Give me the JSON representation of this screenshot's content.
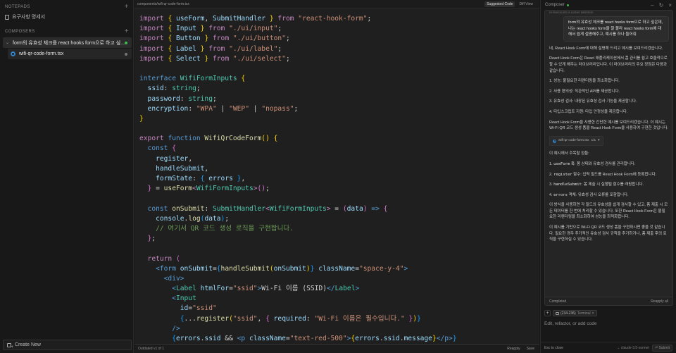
{
  "sidebar": {
    "notepads_header": "NOTEPADS",
    "notepads": [
      {
        "label": "요구사항 명세서",
        "icon": "notepad-icon"
      }
    ],
    "composers_header": "COMPOSERS",
    "composers": [
      {
        "label": "form의 유효성 체크를 react hooks form으로 하고 싶...",
        "expanded": true,
        "status_color": "#3fb950",
        "files": [
          {
            "label": "wifi-qr-code-form.tsx",
            "icon": "gear-file-icon"
          }
        ]
      }
    ],
    "create_new_label": "Create New"
  },
  "editor": {
    "file_path": "components/wifi-qr-code-form.tsx",
    "tabs": [
      {
        "label": "Suggested Code",
        "active": true
      },
      {
        "label": "Diff View",
        "active": false
      }
    ],
    "code_lines": [
      [
        [
          "kw",
          "import "
        ],
        [
          "br1",
          "{ "
        ],
        [
          "var",
          "useForm"
        ],
        [
          "",
          ","
        ],
        [
          "var",
          " SubmitHandler "
        ],
        [
          "br1",
          "}"
        ],
        [
          "kw",
          " from "
        ],
        [
          "str",
          "\"react-hook-form\""
        ],
        [
          "",
          ";"
        ]
      ],
      [
        [
          "kw",
          "import "
        ],
        [
          "br1",
          "{ "
        ],
        [
          "var",
          "Input "
        ],
        [
          "br1",
          "}"
        ],
        [
          "kw",
          " from "
        ],
        [
          "str",
          "\"./ui/input\""
        ],
        [
          "",
          ";"
        ]
      ],
      [
        [
          "kw",
          "import "
        ],
        [
          "br1",
          "{ "
        ],
        [
          "var",
          "Button "
        ],
        [
          "br1",
          "}"
        ],
        [
          "kw",
          " from "
        ],
        [
          "str",
          "\"./ui/button\""
        ],
        [
          "",
          ";"
        ]
      ],
      [
        [
          "kw",
          "import "
        ],
        [
          "br1",
          "{ "
        ],
        [
          "var",
          "Label "
        ],
        [
          "br1",
          "}"
        ],
        [
          "kw",
          " from "
        ],
        [
          "str",
          "\"./ui/label\""
        ],
        [
          "",
          ";"
        ]
      ],
      [
        [
          "kw",
          "import "
        ],
        [
          "br1",
          "{ "
        ],
        [
          "var",
          "Select "
        ],
        [
          "br1",
          "}"
        ],
        [
          "kw",
          " from "
        ],
        [
          "str",
          "\"./ui/select\""
        ],
        [
          "",
          ";"
        ]
      ],
      [],
      [
        [
          "kw2",
          "interface "
        ],
        [
          "ty",
          "WifiFormInputs "
        ],
        [
          "br1",
          "{"
        ]
      ],
      [
        [
          "var",
          "  ssid"
        ],
        [
          "",
          ": "
        ],
        [
          "ty",
          "string"
        ],
        [
          "",
          ";"
        ]
      ],
      [
        [
          "var",
          "  password"
        ],
        [
          "",
          ": "
        ],
        [
          "ty",
          "string"
        ],
        [
          "",
          ";"
        ]
      ],
      [
        [
          "var",
          "  encryption"
        ],
        [
          "",
          ": "
        ],
        [
          "str",
          "\"WPA\""
        ],
        [
          "",
          " | "
        ],
        [
          "str",
          "\"WEP\""
        ],
        [
          "",
          " | "
        ],
        [
          "str",
          "\"nopass\""
        ],
        [
          "",
          ";"
        ]
      ],
      [
        [
          "br1",
          "}"
        ]
      ],
      [],
      [
        [
          "kw",
          "export "
        ],
        [
          "kw2",
          "function "
        ],
        [
          "fn",
          "WifiQrCodeForm"
        ],
        [
          "br1",
          "() {"
        ]
      ],
      [
        [
          "kw2",
          "  const "
        ],
        [
          "br2",
          "{"
        ]
      ],
      [
        [
          "var",
          "    register"
        ],
        [
          "",
          ","
        ]
      ],
      [
        [
          "var",
          "    handleSubmit"
        ],
        [
          "",
          ","
        ]
      ],
      [
        [
          "var",
          "    formState"
        ],
        [
          "",
          ": "
        ],
        [
          "br3",
          "{ "
        ],
        [
          "var",
          "errors "
        ],
        [
          "br3",
          "}"
        ],
        [
          "",
          ","
        ]
      ],
      [
        [
          "br2",
          "  }"
        ],
        [
          "",
          " = "
        ],
        [
          "fn",
          "useForm"
        ],
        [
          "kw",
          "<"
        ],
        [
          "ty",
          "WifiFormInputs"
        ],
        [
          "kw",
          ">"
        ],
        [
          "br2",
          "()"
        ],
        [
          "",
          ";"
        ]
      ],
      [],
      [
        [
          "kw2",
          "  const "
        ],
        [
          "fn",
          "onSubmit"
        ],
        [
          "",
          ": "
        ],
        [
          "ty",
          "SubmitHandler"
        ],
        [
          "kw",
          "<"
        ],
        [
          "ty",
          "WifiFormInputs"
        ],
        [
          "kw",
          ">"
        ],
        [
          "",
          " = "
        ],
        [
          "br2",
          "("
        ],
        [
          "var",
          "data"
        ],
        [
          "br2",
          ")"
        ],
        [
          "kw2",
          " => "
        ],
        [
          "br2",
          "{"
        ]
      ],
      [
        [
          "var",
          "    console"
        ],
        [
          "",
          "."
        ],
        [
          "fn",
          "log"
        ],
        [
          "br3",
          "("
        ],
        [
          "var",
          "data"
        ],
        [
          "br3",
          ")"
        ],
        [
          "",
          ";"
        ]
      ],
      [
        [
          "cm",
          "    // 여기서 QR 코드 생성 로직을 구현합니다."
        ]
      ],
      [
        [
          "br2",
          "  }"
        ],
        [
          "",
          ";"
        ]
      ],
      [],
      [
        [
          "kw",
          "  return "
        ],
        [
          "br2",
          "("
        ]
      ],
      [
        [
          "tag",
          "    <form "
        ],
        [
          "attr",
          "onSubmit"
        ],
        [
          "",
          "="
        ],
        [
          "br3",
          "{"
        ],
        [
          "fn",
          "handleSubmit"
        ],
        [
          "br1",
          "("
        ],
        [
          "var",
          "onSubmit"
        ],
        [
          "br1",
          ")"
        ],
        [
          "br3",
          "}"
        ],
        [
          "attr",
          " className"
        ],
        [
          "",
          "="
        ],
        [
          "str",
          "\"space-y-4\""
        ],
        [
          "tag",
          ">"
        ]
      ],
      [
        [
          "tag",
          "      <div>"
        ]
      ],
      [
        [
          "tag",
          "        <"
        ],
        [
          "cmp",
          "Label "
        ],
        [
          "attr",
          "htmlFor"
        ],
        [
          "",
          "="
        ],
        [
          "str",
          "\"ssid\""
        ],
        [
          "tag",
          ">"
        ],
        [
          "",
          "Wi-Fi 이름 (SSID)"
        ],
        [
          "tag",
          "</"
        ],
        [
          "cmp",
          "Label"
        ],
        [
          "tag",
          ">"
        ]
      ],
      [
        [
          "tag",
          "        <"
        ],
        [
          "cmp",
          "Input"
        ]
      ],
      [
        [
          "attr",
          "          id"
        ],
        [
          "",
          "="
        ],
        [
          "str",
          "\"ssid\""
        ]
      ],
      [
        [
          "br3",
          "          {"
        ],
        [
          "",
          "..."
        ],
        [
          "fn",
          "register"
        ],
        [
          "br1",
          "("
        ],
        [
          "str",
          "\"ssid\""
        ],
        [
          "",
          ", "
        ],
        [
          "br2",
          "{ "
        ],
        [
          "var",
          "required"
        ],
        [
          "",
          ": "
        ],
        [
          "str",
          "\"Wi-Fi 이름은 필수입니다.\""
        ],
        [
          "br2",
          " }"
        ],
        [
          "br1",
          ")"
        ],
        [
          "br3",
          "}"
        ]
      ],
      [
        [
          "tag",
          "        />"
        ]
      ],
      [
        [
          "br3",
          "        {"
        ],
        [
          "var",
          "errors"
        ],
        [
          "",
          "."
        ],
        [
          "var",
          "ssid"
        ],
        [
          "",
          " && "
        ],
        [
          "tag",
          "<p "
        ],
        [
          "attr",
          "className"
        ],
        [
          "",
          "="
        ],
        [
          "str",
          "\"text-red-500\""
        ],
        [
          "tag",
          ">"
        ],
        [
          "br1",
          "{"
        ],
        [
          "var",
          "errors"
        ],
        [
          "",
          "."
        ],
        [
          "var",
          "ssid"
        ],
        [
          "",
          "."
        ],
        [
          "var",
          "message"
        ],
        [
          "br1",
          "}"
        ],
        [
          "tag",
          "</p>"
        ],
        [
          "br3",
          "}"
        ]
      ]
    ],
    "footer_status": "Outdated v1 of 1",
    "footer_reapply": "Reapply",
    "footer_save": "Save"
  },
  "composer": {
    "title": "Composer",
    "status_color": "#3fb950",
    "controls": [
      "minimize",
      "history",
      "close"
    ],
    "scroll_hint": "re-linecounts a corner selection",
    "user_message": "form의 유효성 체크를 react hooks form으로 하고 싶은데, 나는 react hooks form을 잘 몰라 react hooks form에 대해서 쉽게 설명해주고, 예시를 하나 들어줘",
    "assistant": {
      "intro": "네, React Hook Form에 대해 설명해 드리고 예시를 보여드리겠습니다.",
      "desc": "React Hook Form은 React 애플리케이션에서 폼 관리를 쉽고 효율적으로 할 수 있게 해주는 라이브러리입니다. 이 라이브러리의 주요 장점은 다음과 같습니다:",
      "advantages": [
        "1. 성능: 불필요한 리렌더링을 최소화합니다.",
        "2. 사용 편의성: 직관적인 API를 제공합니다.",
        "3. 유효성 검사: 내장된 유효성 검사 기능을 제공합니다.",
        "4. 타입스크립트 지원: 타입 안정성을 제공합니다."
      ],
      "example_intro": "React Hook Form을 사용한 간단한 예시를 보여드리겠습니다. 이 예시는 Wi-Fi QR 코드 생성 폼을 React Hook Form을 사용하여 구현한 것입니다.",
      "file_chip": {
        "name": "wifi-qr-code-form.tsx",
        "version": "1/1"
      },
      "notes_title": "이 예시에서 주목할 점들:",
      "notes": [
        {
          "num": "1.",
          "code": "useForm",
          "text": " 훅: 폼 상태와 유효성 검사를 관리합니다."
        },
        {
          "num": "2.",
          "code": "register",
          "text": " 함수: 입력 필드를 React Hook Form에 등록합니다."
        },
        {
          "num": "3.",
          "code": "handleSubmit",
          "text": ": 폼 제출 시 실행될 함수를 래핑합니다."
        },
        {
          "num": "4.",
          "code": "errors",
          "text": " 객체: 유효성 검사 오류를 포함합니다."
        }
      ],
      "summary": "이 방식을 사용하면 각 필드의 유효성을 쉽게 검사할 수 있고, 폼 제출 시 모든 데이터를 한 번에 처리할 수 있습니다. 또한 React Hook Form은 불필요한 리렌더링을 최소화하여 성능을 최적화합니다.",
      "closing": "이 예시를 기반으로 Wi-Fi QR 코드 생성 폼을 구현하시면 좋을 것 같습니다. 필요한 경우 추가적인 유효성 검사 규칙을 추가하거나, 폼 제출 후의 로직을 구현하실 수 있습니다."
    },
    "chat_status": "Completed",
    "reapply_all": "Reapply all",
    "context_chip": {
      "range": "(234-236)",
      "label": "Terminal"
    },
    "input_placeholder": "Edit, refactor, or add code",
    "input_value": "",
    "esc_hint": "Esc to close",
    "model": "claude-3.5-sonnet",
    "submit_label": "⏎ Submit"
  }
}
